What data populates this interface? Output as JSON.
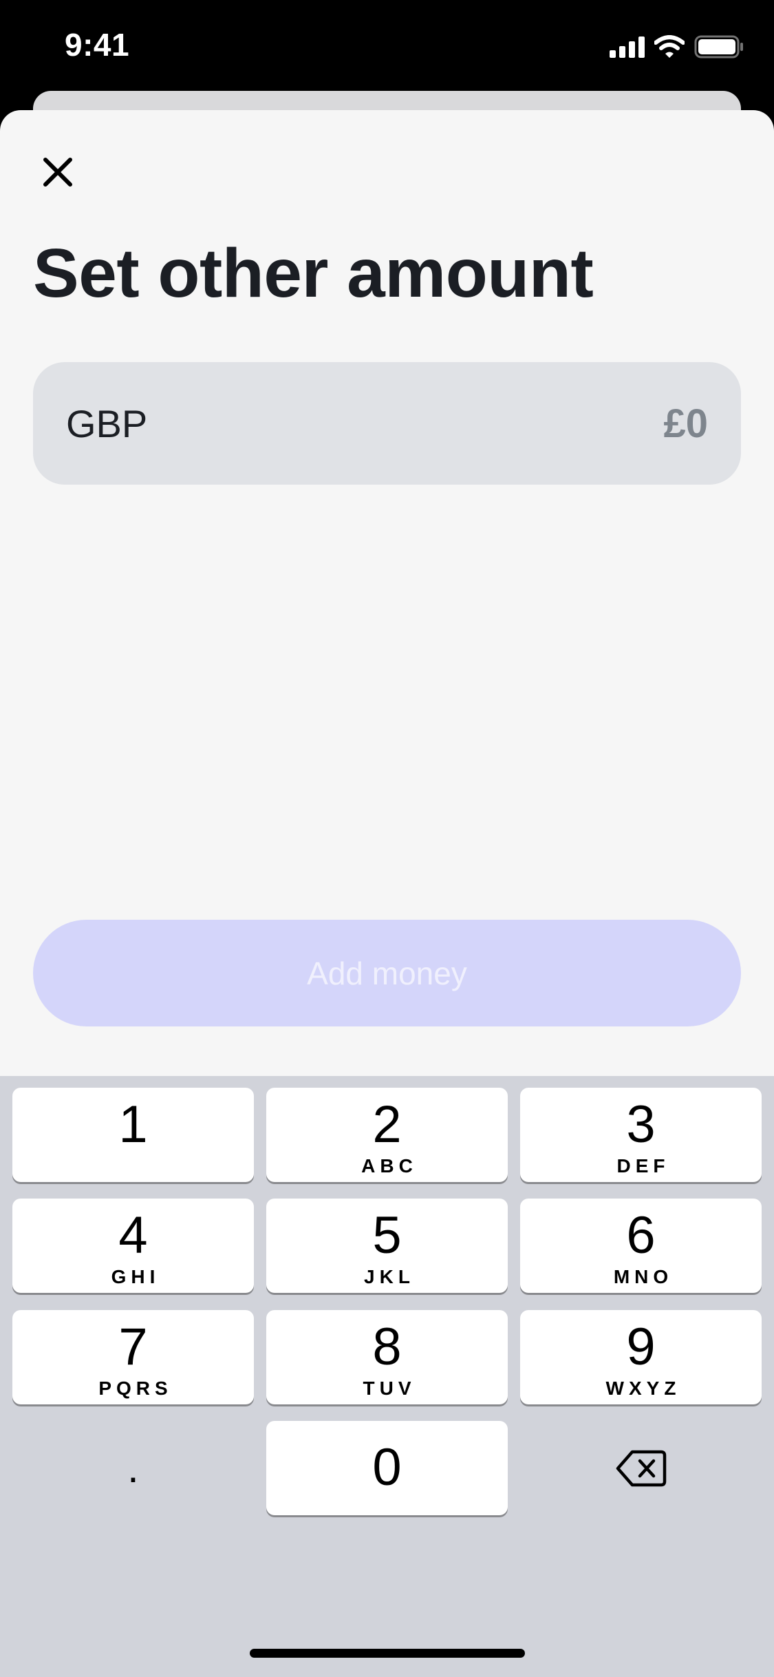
{
  "status_bar": {
    "time": "9:41",
    "icons": [
      "cellular-signal-icon",
      "wifi-icon",
      "battery-icon"
    ]
  },
  "header": {
    "close_icon": "close-icon",
    "title": "Set other amount"
  },
  "amount_field": {
    "currency": "GBP",
    "value": "£0"
  },
  "primary_action": {
    "label": "Add money",
    "enabled": false
  },
  "keypad": {
    "keys": [
      {
        "digit": "1",
        "letters": ""
      },
      {
        "digit": "2",
        "letters": "ABC"
      },
      {
        "digit": "3",
        "letters": "DEF"
      },
      {
        "digit": "4",
        "letters": "GHI"
      },
      {
        "digit": "5",
        "letters": "JKL"
      },
      {
        "digit": "6",
        "letters": "MNO"
      },
      {
        "digit": "7",
        "letters": "PQRS"
      },
      {
        "digit": "8",
        "letters": "TUV"
      },
      {
        "digit": "9",
        "letters": "WXYZ"
      },
      {
        "digit": "0",
        "letters": ""
      }
    ],
    "decimal": ".",
    "backspace_icon": "backspace-icon"
  },
  "colors": {
    "title": "#1b1e24",
    "sheet_background": "#f6f6f6",
    "field_background": "#e0e2e6",
    "amount_placeholder": "#7e858d",
    "button_disabled_background": "#d4d5fa",
    "button_disabled_text": "#f0f0fd",
    "keypad_background": "#d1d3da"
  }
}
